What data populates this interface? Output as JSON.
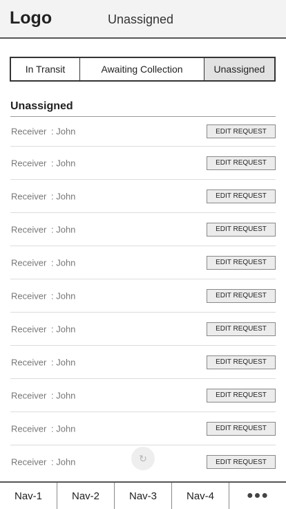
{
  "header": {
    "logo": "Logo",
    "title": "Unassigned"
  },
  "tabs": [
    {
      "label": "In Transit"
    },
    {
      "label": "Awaiting Collection"
    },
    {
      "label": "Unassigned",
      "active": true
    }
  ],
  "section": {
    "title": "Unassigned"
  },
  "rows": [
    {
      "label": "Receiver",
      "value": ": John",
      "action": "EDIT REQUEST"
    },
    {
      "label": "Receiver",
      "value": ": John",
      "action": "EDIT REQUEST"
    },
    {
      "label": "Receiver",
      "value": ": John",
      "action": "EDIT REQUEST"
    },
    {
      "label": "Receiver",
      "value": ": John",
      "action": "EDIT REQUEST"
    },
    {
      "label": "Receiver",
      "value": ": John",
      "action": "EDIT REQUEST"
    },
    {
      "label": "Receiver",
      "value": ": John",
      "action": "EDIT REQUEST"
    },
    {
      "label": "Receiver",
      "value": ": John",
      "action": "EDIT REQUEST"
    },
    {
      "label": "Receiver",
      "value": ": John",
      "action": "EDIT REQUEST"
    },
    {
      "label": "Receiver",
      "value": ": John",
      "action": "EDIT REQUEST"
    },
    {
      "label": "Receiver",
      "value": ": John",
      "action": "EDIT REQUEST"
    },
    {
      "label": "Receiver",
      "value": ": John",
      "action": "EDIT REQUEST"
    }
  ],
  "spinner": {
    "icon": "refresh-icon"
  },
  "nav": [
    {
      "label": "Nav-1"
    },
    {
      "label": "Nav-2"
    },
    {
      "label": "Nav-3"
    },
    {
      "label": "Nav-4"
    },
    {
      "label": "●●●",
      "icon": "more-icon"
    }
  ]
}
